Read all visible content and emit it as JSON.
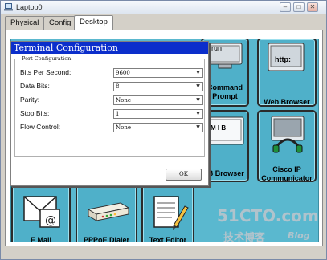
{
  "window": {
    "title": "Laptop0"
  },
  "tabs": [
    {
      "label": "Physical"
    },
    {
      "label": "Config"
    },
    {
      "label": "Desktop"
    }
  ],
  "desktop": {
    "tiles": {
      "command_prompt": {
        "label_line1": "Command",
        "label_line2": "Prompt",
        "screen_text": "run"
      },
      "web_browser": {
        "label": "Web Browser",
        "screen_text": "http:"
      },
      "mib_browser": {
        "label": "IB Browser",
        "screen_text": "M I B"
      },
      "cisco_ip": {
        "label_line1": "Cisco IP",
        "label_line2": "Communicator"
      },
      "email": {
        "label": "E Mail"
      },
      "pppoe": {
        "label": "PPPoE Dialer"
      },
      "text_editor": {
        "label": "Text Editor"
      }
    }
  },
  "dialog": {
    "title": "Terminal Configuration",
    "group_label": "Port Configuration",
    "fields": [
      {
        "label": "Bits Per Second:",
        "value": "9600"
      },
      {
        "label": "Data Bits:",
        "value": "8"
      },
      {
        "label": "Parity:",
        "value": "None"
      },
      {
        "label": "Stop Bits:",
        "value": "1"
      },
      {
        "label": "Flow Control:",
        "value": "None"
      }
    ],
    "ok_label": "OK"
  },
  "watermark": {
    "main": "51CTO.com",
    "sub": "技术博客",
    "blog": "Blog"
  },
  "colors": {
    "desktop_bg": "#5ab8cf",
    "dialog_title_bg": "#0b2ecb"
  }
}
